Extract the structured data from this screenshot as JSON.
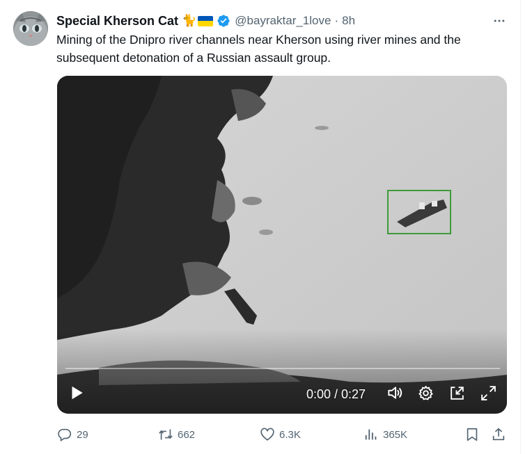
{
  "tweet": {
    "author": {
      "display_name": "Special Kherson Cat",
      "emoji": "🐈",
      "handle": "@bayraktar_1love",
      "separator": "·",
      "time": "8h"
    },
    "text": "Mining of the Dnipro river channels near Kherson using river mines and the subsequent detonation of a Russian assault group.",
    "video": {
      "time_display": "0:00 / 0:27",
      "progress": 0
    },
    "actions": {
      "replies": "29",
      "retweets": "662",
      "likes": "6.3K",
      "views": "365K"
    }
  },
  "colors": {
    "text_primary": "#0f1419",
    "text_secondary": "#536471",
    "verified": "#1d9bf0",
    "flag_blue": "#0057b7",
    "flag_yellow": "#ffd700",
    "target_box": "#3f9a3a"
  },
  "icons": [
    "avatar-cat",
    "cat-emoji",
    "ukraine-flag",
    "verified-badge-icon",
    "more-dots-icon",
    "play-icon",
    "volume-icon",
    "gear-icon",
    "pip-icon",
    "fullscreen-icon",
    "reply-icon",
    "retweet-icon",
    "like-icon",
    "views-icon",
    "bookmark-icon",
    "share-icon"
  ]
}
